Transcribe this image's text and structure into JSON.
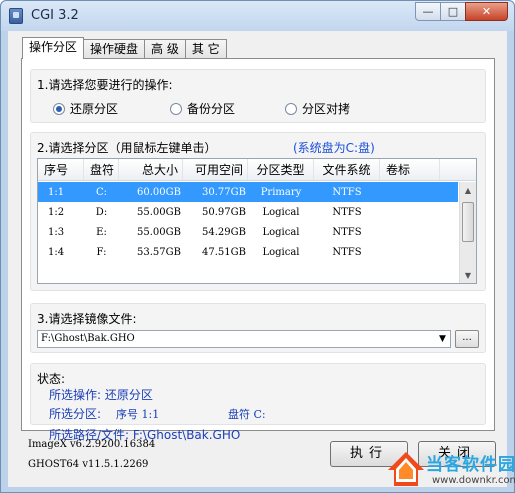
{
  "window": {
    "title": "CGI 3.2",
    "minimize_glyph": "—",
    "maximize_glyph": "□",
    "close_glyph": "✕"
  },
  "tabs": [
    {
      "label": "操作分区",
      "active": true
    },
    {
      "label": "操作硬盘"
    },
    {
      "label": "高 级"
    },
    {
      "label": "其 它"
    }
  ],
  "operation": {
    "label": "1.请选择您要进行的操作:",
    "options": [
      {
        "label": "还原分区",
        "checked": true
      },
      {
        "label": "备份分区",
        "checked": false
      },
      {
        "label": "分区对拷",
        "checked": false
      }
    ]
  },
  "partition": {
    "label": "2.请选择分区（用鼠标左键单击）",
    "system_note": "(系统盘为C:盘)",
    "columns": [
      "序号",
      "盘符",
      "总大小",
      "可用空间",
      "分区类型",
      "文件系统",
      "卷标"
    ],
    "rows": [
      {
        "num": "1:1",
        "drive": "C:",
        "total": "60.00GB",
        "free": "30.77GB",
        "type": "Primary",
        "fs": "NTFS",
        "label": ""
      },
      {
        "num": "1:2",
        "drive": "D:",
        "total": "55.00GB",
        "free": "50.97GB",
        "type": "Logical",
        "fs": "NTFS",
        "label": ""
      },
      {
        "num": "1:3",
        "drive": "E:",
        "total": "55.00GB",
        "free": "54.29GB",
        "type": "Logical",
        "fs": "NTFS",
        "label": ""
      },
      {
        "num": "1:4",
        "drive": "F:",
        "total": "53.57GB",
        "free": "47.51GB",
        "type": "Logical",
        "fs": "NTFS",
        "label": ""
      }
    ]
  },
  "image_file": {
    "label": "3.请选择镜像文件:",
    "value": "F:\\Ghost\\Bak.GHO",
    "browse_label": "..."
  },
  "status": {
    "label": "状态:",
    "operation": "所选操作: 还原分区",
    "partition_prefix": "所选分区:",
    "partition_num": "序号 1:1",
    "partition_drive": "盘符 C:",
    "path": "所选路径/文件: F:\\Ghost\\Bak.GHO"
  },
  "versions": {
    "imagex": "ImageX v6.2.9200.16384",
    "ghost": "GHOST64 v11.5.1.2269"
  },
  "buttons": {
    "execute": "执行",
    "close": "关闭"
  },
  "watermark": {
    "name": "当客软件园",
    "url": "www.downkr.com"
  },
  "colors": {
    "accent_blue": "#1a3fb8",
    "selection": "#3399ff",
    "note_blue": "#1a4fd8"
  }
}
